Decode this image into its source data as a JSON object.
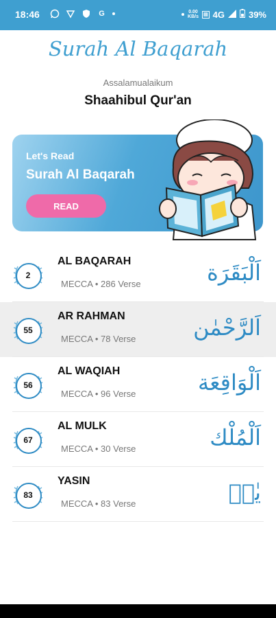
{
  "status_bar": {
    "time": "18:46",
    "network_speed": "0.00\nKB/s",
    "network_type": "4G",
    "battery": "39%"
  },
  "app_title": "Surah Al Baqarah",
  "greeting": "Assalamualaikum",
  "user_name": "Shaahibul Qur'an",
  "banner": {
    "subtitle": "Let's Read",
    "title": "Surah Al Baqarah",
    "button_label": "READ"
  },
  "surahs": [
    {
      "number": "2",
      "name": "AL BAQARAH",
      "place": "MECCA",
      "verses": "286 Verse",
      "arabic": "اَلْبَقَرَة"
    },
    {
      "number": "55",
      "name": "AR RAHMAN",
      "place": "MECCA",
      "verses": "78 Verse",
      "arabic": "اَلرَّحْمٰن"
    },
    {
      "number": "56",
      "name": "AL WAQIAH",
      "place": "MECCA",
      "verses": "96 Verse",
      "arabic": "اَلْوَاقِعَة"
    },
    {
      "number": "67",
      "name": "AL MULK",
      "place": "MECCA",
      "verses": "30 Verse",
      "arabic": "اَلْمُلْك"
    },
    {
      "number": "83",
      "name": "YASIN",
      "place": "MECCA",
      "verses": "83 Verse",
      "arabic": "يٰسۤ"
    }
  ],
  "separator": "•",
  "colors": {
    "primary": "#3f9fd0",
    "accent": "#ef6aa9",
    "badge": "#2e8bc4"
  }
}
